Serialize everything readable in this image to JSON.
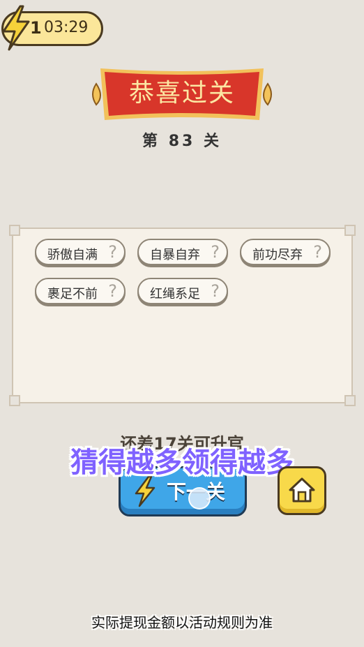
{
  "energy": {
    "count": "1",
    "timer": "03:29"
  },
  "banner": {
    "title": "恭喜过关"
  },
  "level": {
    "label": "第 83 关"
  },
  "idioms": [
    {
      "text": "骄傲自满",
      "hint": "?"
    },
    {
      "text": "自暴自弃",
      "hint": "?"
    },
    {
      "text": "前功尽弃",
      "hint": "?"
    },
    {
      "text": "裹足不前",
      "hint": "?"
    },
    {
      "text": "红绳系足",
      "hint": "?"
    }
  ],
  "progress": {
    "text": "还差17关可升官"
  },
  "overlay": {
    "text": "猜得越多领得越多"
  },
  "buttons": {
    "next_label": "下一关",
    "home_icon": "home-icon"
  },
  "caption": {
    "text": "实际提现金额以活动规则为准"
  },
  "colors": {
    "background": "#e7e3dc",
    "banner_red": "#d8362a",
    "next_blue": "#3fa6e8",
    "home_yellow": "#f8d94a",
    "overlay_purple": "#7f62ff"
  }
}
